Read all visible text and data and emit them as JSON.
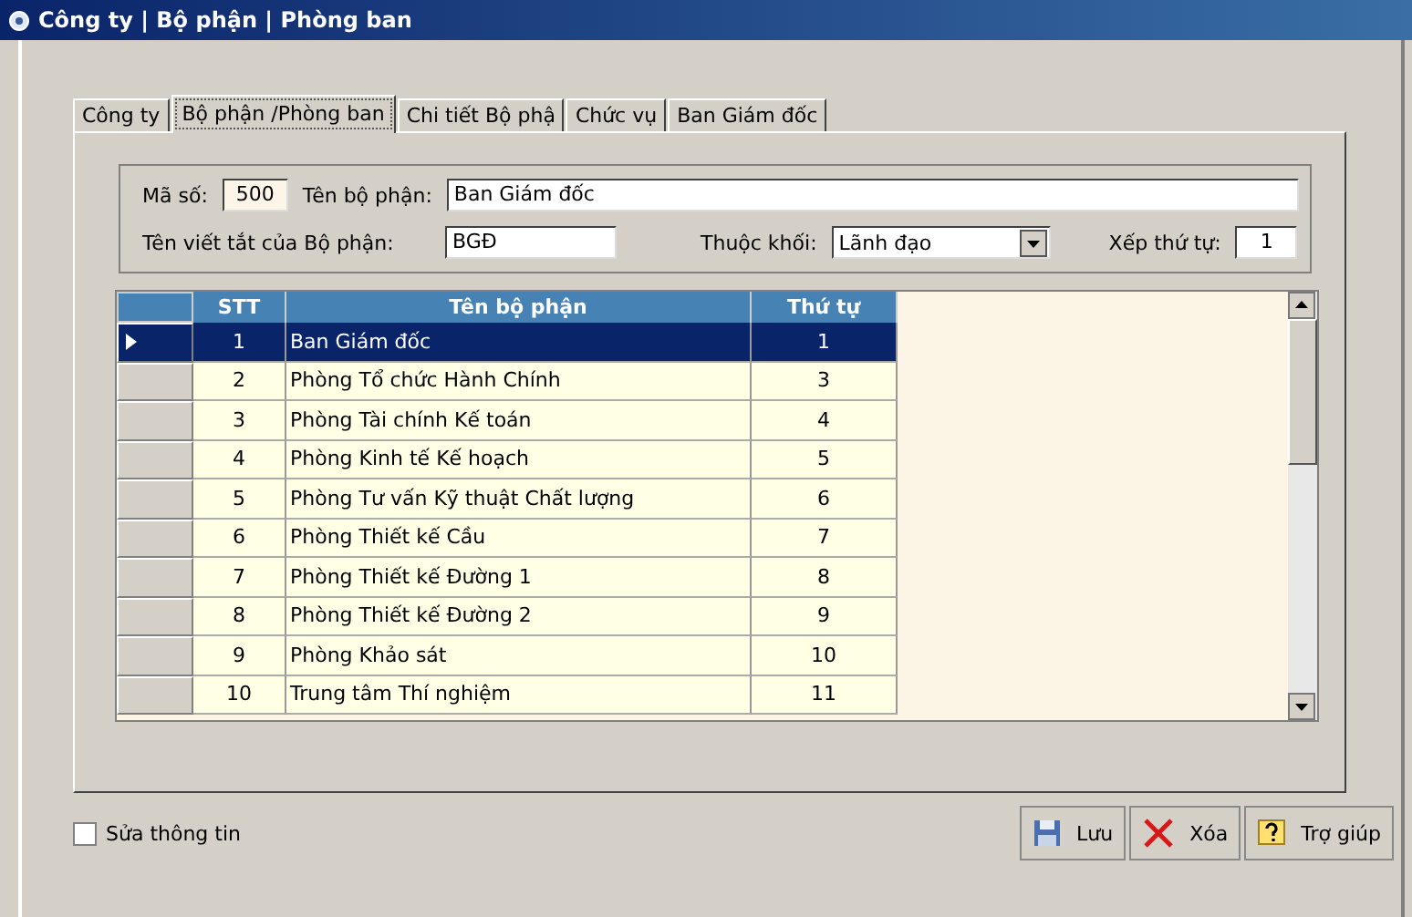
{
  "window": {
    "title": "Công ty | Bộ phận | Phòng ban"
  },
  "tabs": [
    {
      "label": "Công ty",
      "selected": false
    },
    {
      "label": "Bộ phận /Phòng ban",
      "selected": true
    },
    {
      "label": "Chi tiết Bộ phậ",
      "selected": false
    },
    {
      "label": "Chức vụ",
      "selected": false
    },
    {
      "label": "Ban Giám đốc",
      "selected": false
    }
  ],
  "form": {
    "code_label": "Mã số:",
    "code": "500",
    "name_label": "Tên bộ phận:",
    "name": "Ban Giám đốc",
    "abbr_label": "Tên viết tắt của Bộ phận:",
    "abbr": "BGĐ",
    "block_label": "Thuộc khối:",
    "block": "Lãnh đạo",
    "order_label": "Xếp thứ tự:",
    "order": "1"
  },
  "table": {
    "columns": [
      "STT",
      "Tên bộ phận",
      "Thứ tự"
    ],
    "rows": [
      {
        "cells": [
          "1",
          "Ban Giám đốc",
          "1"
        ],
        "selected": true
      },
      {
        "cells": [
          "2",
          "Phòng Tổ chức Hành Chính",
          "3"
        ],
        "selected": false
      },
      {
        "cells": [
          "3",
          "Phòng Tài chính Kế toán",
          "4"
        ],
        "selected": false
      },
      {
        "cells": [
          "4",
          "Phòng Kinh tế Kế hoạch",
          "5"
        ],
        "selected": false
      },
      {
        "cells": [
          "5",
          "Phòng Tư vấn Kỹ thuật Chất lượng",
          "6"
        ],
        "selected": false
      },
      {
        "cells": [
          "6",
          "Phòng Thiết kế Cầu",
          "7"
        ],
        "selected": false
      },
      {
        "cells": [
          "7",
          "Phòng Thiết kế  Đường 1",
          "8"
        ],
        "selected": false
      },
      {
        "cells": [
          "8",
          "Phòng Thiết kế  Đường 2",
          "9"
        ],
        "selected": false
      },
      {
        "cells": [
          "9",
          "Phòng Khảo sát",
          "10"
        ],
        "selected": false
      },
      {
        "cells": [
          "10",
          "Trung tâm Thí nghiệm",
          "11"
        ],
        "selected": false
      }
    ]
  },
  "edit_checkbox": {
    "label": "Sửa thông tin",
    "checked": false
  },
  "buttons": [
    {
      "kind": "save",
      "label": "Lưu"
    },
    {
      "kind": "delete",
      "label": "Xóa"
    },
    {
      "kind": "help",
      "label": "Trợ giúp"
    }
  ]
}
